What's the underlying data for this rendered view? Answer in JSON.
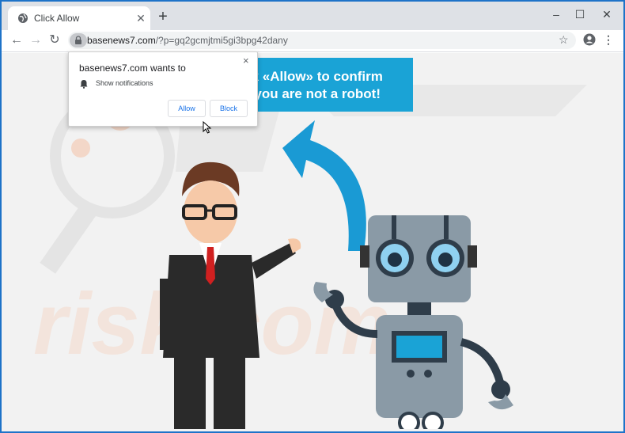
{
  "tab": {
    "title": "Click Allow",
    "close_icon": "close-icon",
    "favicon": "globe-icon"
  },
  "new_tab_label": "+",
  "window_controls": {
    "minimize": "–",
    "maximize": "☐",
    "close": "✕"
  },
  "toolbar": {
    "back": "←",
    "forward": "→",
    "reload": "↻",
    "url_host": "basenews7.com",
    "url_rest": "/?p=gq2gcmjtmi5gi3bpg42dany",
    "star": "☆",
    "menu": "⋮"
  },
  "banner": {
    "line1": "ck «Allow» to confirm",
    "line2": "t you are not a robot!"
  },
  "popup": {
    "title": "basenews7.com wants to",
    "close": "×",
    "permission": "Show notifications",
    "allow": "Allow",
    "block": "Block"
  },
  "colors": {
    "banner_bg": "#1aa3d6",
    "link_blue": "#1a73e8",
    "frame_blue": "#1e73c8"
  }
}
